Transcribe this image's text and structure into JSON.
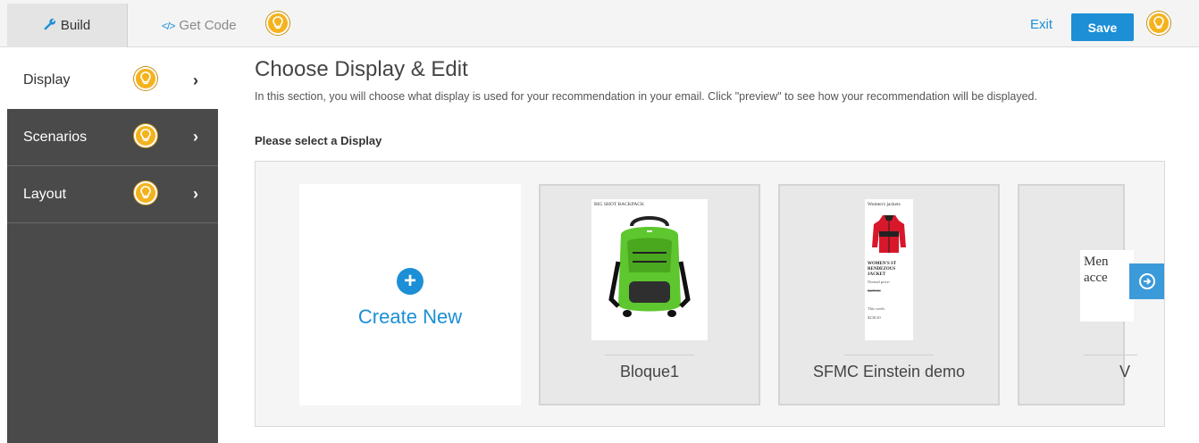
{
  "topbar": {
    "build_label": "Build",
    "getcode_label": "Get Code",
    "exit_label": "Exit",
    "save_label": "Save"
  },
  "sidebar": {
    "items": [
      {
        "label": "Display",
        "chevron": "›"
      },
      {
        "label": "Scenarios",
        "chevron": "›"
      },
      {
        "label": "Layout",
        "chevron": "›"
      }
    ]
  },
  "main": {
    "title": "Choose Display & Edit",
    "description": "In this section, you will choose what display is used for your recommendation in your email. Click \"preview\" to see how your recommendation will be displayed.",
    "section_label": "Please select a Display",
    "create_new_label": "Create New",
    "cards": [
      {
        "name": "Bloque1",
        "thumb_title": "BIG SHOT BACKPACK"
      },
      {
        "name": "SFMC Einstein demo",
        "thumb_title": "Women's jackets",
        "thumb_product": "WOMEN'S ST RENDEZOUS JACKET",
        "thumb_normal_label": "Normal price:",
        "thumb_normal_price": "$289.00",
        "thumb_week_label": "This week:",
        "thumb_week_price": "$238.20"
      },
      {
        "name": "V",
        "thumb_text": "Men acce"
      }
    ]
  },
  "colors": {
    "accent": "#1c8fd6",
    "bulb": "#f4b21c",
    "sidebar_bg": "#4a4a4a"
  },
  "icons": {
    "build": "wrench-icon",
    "getcode": "code-icon",
    "help": "lightbulb-icon",
    "create": "plus-circle-icon",
    "next": "arrow-right-circle-icon"
  }
}
